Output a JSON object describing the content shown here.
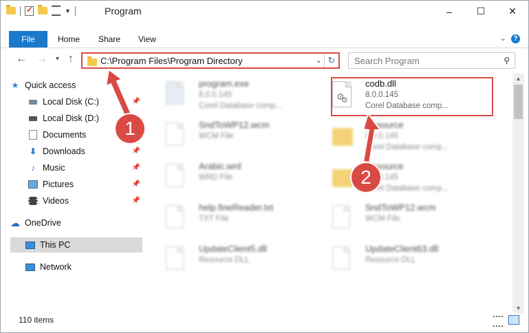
{
  "window": {
    "title": "Program",
    "buttons": {
      "minimize": "–",
      "maximize": "☐",
      "close": "✕"
    }
  },
  "ribbon": {
    "tabs": [
      "File",
      "Home",
      "Share",
      "View"
    ],
    "help": "?"
  },
  "navigation": {
    "address": "C:\\Program Files\\Program Directory",
    "search_placeholder": "Search Program"
  },
  "sidebar": {
    "items": [
      {
        "label": "Quick access",
        "icon": "star-icon"
      },
      {
        "label": "Local Disk (C:)",
        "icon": "drive-icon",
        "pinned": true
      },
      {
        "label": "Local Disk (D:)",
        "icon": "drive-icon"
      },
      {
        "label": "Documents",
        "icon": "documents-icon"
      },
      {
        "label": "Downloads",
        "icon": "download-icon",
        "pinned": true
      },
      {
        "label": "Music",
        "icon": "music-icon",
        "pinned": true
      },
      {
        "label": "Pictures",
        "icon": "pictures-icon",
        "pinned": true
      },
      {
        "label": "Videos",
        "icon": "videos-icon",
        "pinned": true
      },
      {
        "label": "OneDrive",
        "icon": "cloud-icon"
      },
      {
        "label": "This PC",
        "icon": "computer-icon",
        "selected": true
      },
      {
        "label": "Network",
        "icon": "network-icon"
      }
    ]
  },
  "files": [
    {
      "name": "program.exe",
      "line2": "8.0.0.145",
      "line3": "Corel Database comp...",
      "icon": "exe-icon",
      "blurred": true
    },
    {
      "name": "codb.dll",
      "line2": "8.0.0.145",
      "line3": "Corel Database comp...",
      "icon": "dll-icon",
      "blurred": false,
      "highlighted": true
    },
    {
      "name": "SndToWP12.wcm",
      "line2": "WCM File",
      "line3": "",
      "icon": "file-icon",
      "blurred": true
    },
    {
      "name": "Resource",
      "line2": "8.0.0.145",
      "line3": "Corel Database comp...",
      "icon": "folder-icon",
      "blurred": true
    },
    {
      "name": "Arabic.wrd",
      "line2": "WRD File",
      "line3": "",
      "icon": "file-icon",
      "blurred": true
    },
    {
      "name": "Resource",
      "line2": "8.0.0.145",
      "line3": "Corel Database comp...",
      "icon": "folder-icon",
      "blurred": true
    },
    {
      "name": "help.fineReader.txt",
      "line2": "TXT File",
      "line3": "",
      "icon": "file-icon",
      "blurred": true
    },
    {
      "name": "SndToWP12.wcm",
      "line2": "WCM File",
      "line3": "",
      "icon": "file-icon",
      "blurred": true
    },
    {
      "name": "UpdateClient5.dll",
      "line2": "Resource DLL",
      "line3": "",
      "icon": "dll-icon",
      "blurred": true
    },
    {
      "name": "UpdateClient63.dll",
      "line2": "Resource DLL",
      "line3": "",
      "icon": "dll-icon",
      "blurred": true
    }
  ],
  "status": {
    "count": "110 items"
  },
  "callouts": [
    "1",
    "2"
  ],
  "colors": {
    "accent": "#1979ca",
    "highlight": "#d94a45",
    "selected_bg": "#d9d9d9"
  }
}
